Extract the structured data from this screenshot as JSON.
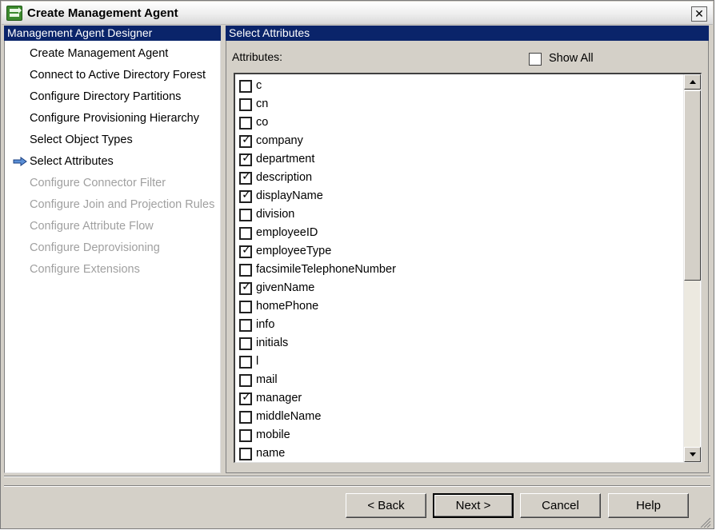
{
  "window": {
    "title": "Create Management Agent",
    "close_symbol": "✕"
  },
  "left_header": "Management Agent Designer",
  "right_header": "Select Attributes",
  "steps": [
    {
      "label": "Create Management Agent",
      "state": "enabled"
    },
    {
      "label": "Connect to Active Directory Forest",
      "state": "enabled"
    },
    {
      "label": "Configure Directory Partitions",
      "state": "enabled"
    },
    {
      "label": "Configure Provisioning Hierarchy",
      "state": "enabled"
    },
    {
      "label": "Select Object Types",
      "state": "enabled"
    },
    {
      "label": "Select Attributes",
      "state": "current"
    },
    {
      "label": "Configure Connector Filter",
      "state": "disabled"
    },
    {
      "label": "Configure Join and Projection Rules",
      "state": "disabled"
    },
    {
      "label": "Configure Attribute Flow",
      "state": "disabled"
    },
    {
      "label": "Configure Deprovisioning",
      "state": "disabled"
    },
    {
      "label": "Configure Extensions",
      "state": "disabled"
    }
  ],
  "attributes_label": "Attributes:",
  "show_all": {
    "label": "Show All",
    "checked": false
  },
  "attributes": [
    {
      "name": "c",
      "checked": false
    },
    {
      "name": "cn",
      "checked": false
    },
    {
      "name": "co",
      "checked": false
    },
    {
      "name": "company",
      "checked": true
    },
    {
      "name": "department",
      "checked": true
    },
    {
      "name": "description",
      "checked": true
    },
    {
      "name": "displayName",
      "checked": true
    },
    {
      "name": "division",
      "checked": false
    },
    {
      "name": "employeeID",
      "checked": false
    },
    {
      "name": "employeeType",
      "checked": true
    },
    {
      "name": "facsimileTelephoneNumber",
      "checked": false
    },
    {
      "name": "givenName",
      "checked": true
    },
    {
      "name": "homePhone",
      "checked": false
    },
    {
      "name": "info",
      "checked": false
    },
    {
      "name": "initials",
      "checked": false
    },
    {
      "name": "l",
      "checked": false
    },
    {
      "name": "mail",
      "checked": false
    },
    {
      "name": "manager",
      "checked": true
    },
    {
      "name": "middleName",
      "checked": false
    },
    {
      "name": "mobile",
      "checked": false
    },
    {
      "name": "name",
      "checked": false
    }
  ],
  "check_symbol": "✓",
  "buttons": {
    "back": "< Back",
    "next": "Next >",
    "cancel": "Cancel",
    "help": "Help"
  },
  "icons": {
    "app": "management-agent-icon",
    "current_step": "arrow-right-icon",
    "close": "close-icon"
  },
  "colors": {
    "header_bg": "#0a246a",
    "dialog_bg": "#d4d0c8",
    "disabled_text": "#a0a0a0"
  }
}
